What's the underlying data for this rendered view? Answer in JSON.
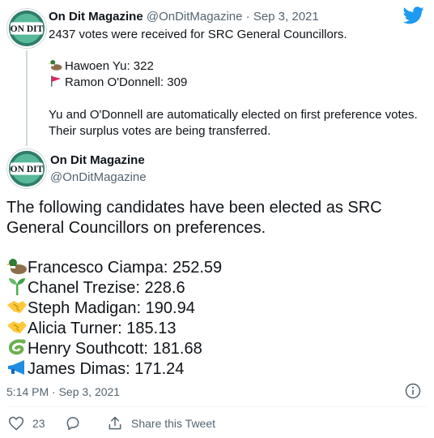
{
  "tweet1": {
    "author_name": "On Dit Magazine",
    "handle": "@OnDitMagazine",
    "separator": "·",
    "date": "Sep 3, 2021",
    "line1": "2437 votes were received for SRC General Councillors.",
    "results": [
      {
        "icon": "duck-icon",
        "text": "Hawoen Yu: 322"
      },
      {
        "icon": "red-flag-icon",
        "text": "Ramon O'Donnell: 309"
      }
    ],
    "para_line1": "Yu and O'Donnell are automatically elected on first preference votes.",
    "para_line2": "Their surplus votes are being transferred."
  },
  "tweet2": {
    "author_name": "On Dit Magazine",
    "handle": "@OnDitMagazine",
    "intro_line1": "The following candidates have been elected as SRC",
    "intro_line2": "General Councillors on preferences.",
    "candidates": [
      {
        "icon": "duck-icon",
        "text": "Francesco Ciampa: 252.59"
      },
      {
        "icon": "seedling-icon",
        "text": "Chanel Trezise: 228.6"
      },
      {
        "icon": "handshake-icon",
        "text": "Steph Madigan: 190.94"
      },
      {
        "icon": "handshake-icon",
        "text": "Alicia Turner: 185.13"
      },
      {
        "icon": "snake-icon",
        "text": "Henry Southcott: 181.68"
      },
      {
        "icon": "megaphone-icon",
        "text": "James Dimas: 171.24"
      }
    ],
    "timestamp": "5:14 PM · Sep 3, 2021",
    "likes": "23",
    "share_label": "Share this Tweet"
  },
  "avatar_logo_text": "ON DIT",
  "colors": {
    "twitter_blue": "#1d9bf0",
    "muted": "#536471",
    "avatar_green": "#3a9a5a"
  }
}
